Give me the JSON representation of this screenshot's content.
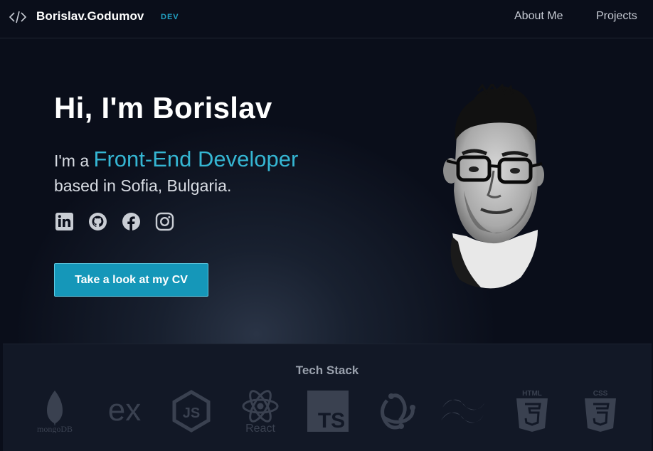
{
  "header": {
    "logo_glyph": "</>",
    "brand_name": "Borislav.Godumov",
    "brand_tag": "DEV",
    "nav": [
      {
        "label": "About Me"
      },
      {
        "label": "Projects"
      }
    ]
  },
  "hero": {
    "title": "Hi, I'm Borislav",
    "line1_prefix": "I'm a ",
    "role": "Front-End Developer",
    "line2": "based in Sofia, Bulgaria.",
    "socials": [
      {
        "icon": "linkedin-icon"
      },
      {
        "icon": "github-icon"
      },
      {
        "icon": "facebook-icon"
      },
      {
        "icon": "instagram-icon"
      }
    ],
    "cv_button": "Take a look at my CV"
  },
  "tech_stack": {
    "title": "Tech Stack",
    "items": [
      {
        "icon": "mongodb-icon",
        "label": "mongoDB"
      },
      {
        "icon": "express-icon",
        "label": "ex"
      },
      {
        "icon": "nodejs-icon",
        "label": "JS"
      },
      {
        "icon": "react-icon",
        "label": "React"
      },
      {
        "icon": "typescript-icon",
        "label": "TS"
      },
      {
        "icon": "redux-icon"
      },
      {
        "icon": "tailwind-icon"
      },
      {
        "icon": "html5-icon",
        "label": "HTML"
      },
      {
        "icon": "css3-icon",
        "label": "CSS"
      }
    ]
  },
  "colors": {
    "background": "#0a0e1a",
    "accent": "#35b6d3",
    "button": "#1597b9",
    "panel": "#121826",
    "muted_logo": "#3a4150"
  }
}
